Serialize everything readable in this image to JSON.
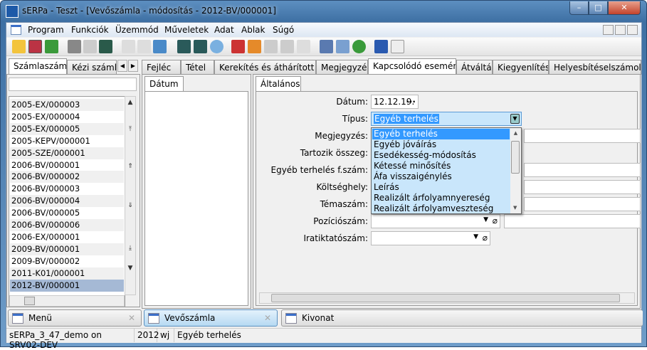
{
  "window": {
    "title": "sERPa - Teszt - [Vevőszámla - módosítás - 2012-BV/000001]",
    "minimize": "–",
    "maximize": "□",
    "close": "✕"
  },
  "menu": [
    "Program",
    "Funkciók",
    "Üzemmód",
    "Műveletek",
    "Adat",
    "Ablak",
    "Súgó"
  ],
  "left_tabs": [
    "Számlaszám",
    "Kézi számlas"
  ],
  "left_list": [
    "2005-EX/000003",
    "2005-EX/000004",
    "2005-EX/000005",
    "2005-KEPV/000001",
    "2005-SZE/000001",
    "2006-BV/000001",
    "2006-BV/000002",
    "2006-BV/000003",
    "2006-BV/000004",
    "2006-BV/000005",
    "2006-BV/000006",
    "2006-EX/000001",
    "2009-BV/000001",
    "2009-BV/000002",
    "2011-K01/000001",
    "2012-BV/000001"
  ],
  "right_tabs": [
    "Fejléc",
    "Tétel",
    "Kerekítés és áthárított áfa",
    "Megjegyzés",
    "Kapcsolódó esemény",
    "Átváltás",
    "Kiegyenlítés",
    "Helyesbítéselszámolás"
  ],
  "datum_tab": "Dátum",
  "general_tab": "Általános",
  "form": {
    "labels": [
      "Dátum:",
      "Típus:",
      "Megjegyzés:",
      "Tartozik összeg:",
      "Egyéb terhelés f.szám:",
      "Költséghely:",
      "Témaszám:",
      "Pozíciószám:",
      "Iratiktatószám:"
    ],
    "datum_value": "12.12.19.",
    "datum_button": "···",
    "tipus_value": "Egyéb terhelés"
  },
  "dropdown_options": [
    "Egyéb terhelés",
    "Egyéb jóváírás",
    "Esedékesség-módosítás",
    "Kétessé minősítés",
    "Áfa visszaigénylés",
    "Leírás",
    "Realizált árfolyamnyereség",
    "Realizált árfolyamveszteség"
  ],
  "bottom_tabs": [
    "Menü",
    "Vevőszámla",
    "Kivonat"
  ],
  "status": [
    "sERPa_3_47_demo on SRV02-DEV",
    "2012",
    "wj",
    "Egyéb terhelés"
  ]
}
